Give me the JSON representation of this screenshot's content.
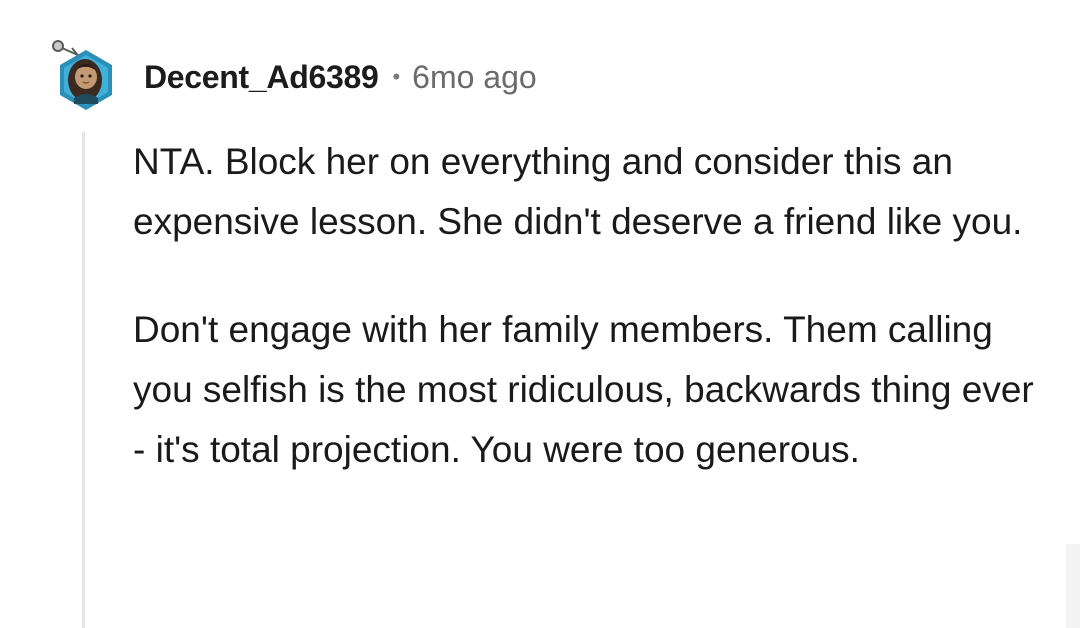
{
  "comment": {
    "author": "Decent_Ad6389",
    "separator": "•",
    "timestamp": "6mo ago",
    "avatar_icon": "snoo-avatar-icon",
    "paragraphs": [
      "NTA. Block her on everything and consider this an expensive lesson. She didn't deserve a friend like you.",
      "Don't engage with her family members. Them calling you selfish is the most ridiculous, backwards thing ever - it's total projection. You were too generous."
    ]
  },
  "colors": {
    "background": "#ffffff",
    "text": "#1a1a1b",
    "meta": "#6b6b6b",
    "thread_line": "#e2e4e6",
    "avatar_ring": "#2b8fb8"
  }
}
